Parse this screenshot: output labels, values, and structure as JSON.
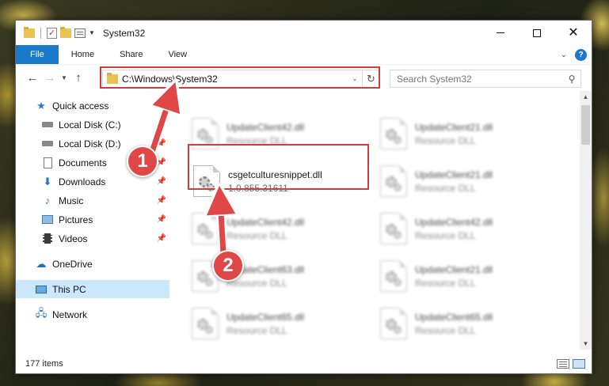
{
  "window": {
    "title": "System32",
    "controls": {
      "minimize": "minimize",
      "maximize": "maximize",
      "close": "close"
    }
  },
  "ribbon": {
    "tabs": [
      "File",
      "Home",
      "Share",
      "View"
    ],
    "help": "?"
  },
  "nav": {
    "address": "C:\\Windows\\System32",
    "search_placeholder": "Search System32"
  },
  "sidebar": {
    "items": [
      {
        "label": "Quick access",
        "icon": "star-icon",
        "pinned": false
      },
      {
        "label": "Local Disk (C:)",
        "icon": "drive-icon",
        "pinned": true
      },
      {
        "label": "Local Disk (D:)",
        "icon": "drive-icon",
        "pinned": true
      },
      {
        "label": "Documents",
        "icon": "documents-icon",
        "pinned": true
      },
      {
        "label": "Downloads",
        "icon": "download-icon",
        "pinned": true
      },
      {
        "label": "Music",
        "icon": "music-icon",
        "pinned": true
      },
      {
        "label": "Pictures",
        "icon": "pictures-icon",
        "pinned": true
      },
      {
        "label": "Videos",
        "icon": "videos-icon",
        "pinned": true
      },
      {
        "label": "OneDrive",
        "icon": "cloud-icon",
        "pinned": false
      },
      {
        "label": "This PC",
        "icon": "computer-icon",
        "pinned": false,
        "selected": true
      },
      {
        "label": "Network",
        "icon": "network-icon",
        "pinned": false
      }
    ]
  },
  "files": {
    "highlighted": {
      "name": "csgetculturesnippet.dll",
      "version": "1.0.855.31611"
    },
    "background": [
      {
        "name": "UpdateClient42.dll",
        "type": "Resource DLL"
      },
      {
        "name": "UpdateClient21.dll",
        "type": "Resource DLL"
      },
      {
        "name": "UpdateClient21.dll",
        "type": "Resource DLL"
      },
      {
        "name": "UpdateClient42.dll",
        "type": "Resource DLL"
      },
      {
        "name": "UpdateClient42.dll",
        "type": "Resource DLL"
      },
      {
        "name": "UpdateClient63.dll",
        "type": "Resource DLL"
      },
      {
        "name": "UpdateClient21.dll",
        "type": "Resource DLL"
      },
      {
        "name": "UpdateClient65.dll",
        "type": "Resource DLL"
      },
      {
        "name": "UpdateClient65.dll",
        "type": "Resource DLL"
      }
    ]
  },
  "status": {
    "item_count": "177 items"
  },
  "annotations": {
    "step1": "1",
    "step2": "2"
  },
  "colors": {
    "accent": "#1979ca",
    "highlight_box": "#d23c3c",
    "badge": "#e04848",
    "selected_bg": "#cce8ff"
  }
}
